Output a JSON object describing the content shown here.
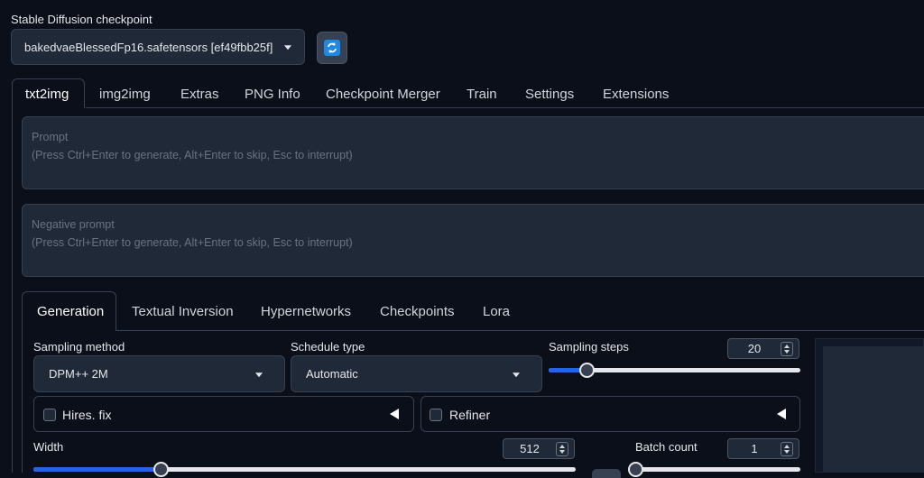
{
  "checkpoint": {
    "label": "Stable Diffusion checkpoint",
    "selected": "bakedvaeBlessedFp16.safetensors [ef49fbb25f]"
  },
  "main_tabs": [
    "txt2img",
    "img2img",
    "Extras",
    "PNG Info",
    "Checkpoint Merger",
    "Train",
    "Settings",
    "Extensions"
  ],
  "prompt": {
    "placeholder_title": "Prompt",
    "placeholder_hint": "(Press Ctrl+Enter to generate, Alt+Enter to skip, Esc to interrupt)"
  },
  "negative_prompt": {
    "placeholder_title": "Negative prompt",
    "placeholder_hint": "(Press Ctrl+Enter to generate, Alt+Enter to skip, Esc to interrupt)"
  },
  "sub_tabs": [
    "Generation",
    "Textual Inversion",
    "Hypernetworks",
    "Checkpoints",
    "Lora"
  ],
  "sampling_method": {
    "label": "Sampling method",
    "value": "DPM++ 2M"
  },
  "schedule_type": {
    "label": "Schedule type",
    "value": "Automatic"
  },
  "sampling_steps": {
    "label": "Sampling steps",
    "value": "20",
    "fraction": 0.15
  },
  "hires_fix": {
    "label": "Hires. fix"
  },
  "refiner": {
    "label": "Refiner"
  },
  "width": {
    "label": "Width",
    "value": "512",
    "fraction": 0.235
  },
  "batch_count": {
    "label": "Batch count",
    "value": "1",
    "fraction": 0.0
  },
  "colors": {
    "background": "#0b0f19",
    "panel": "#1f2937",
    "accent": "#2563eb",
    "refresh_icon": "#1e88e5"
  }
}
